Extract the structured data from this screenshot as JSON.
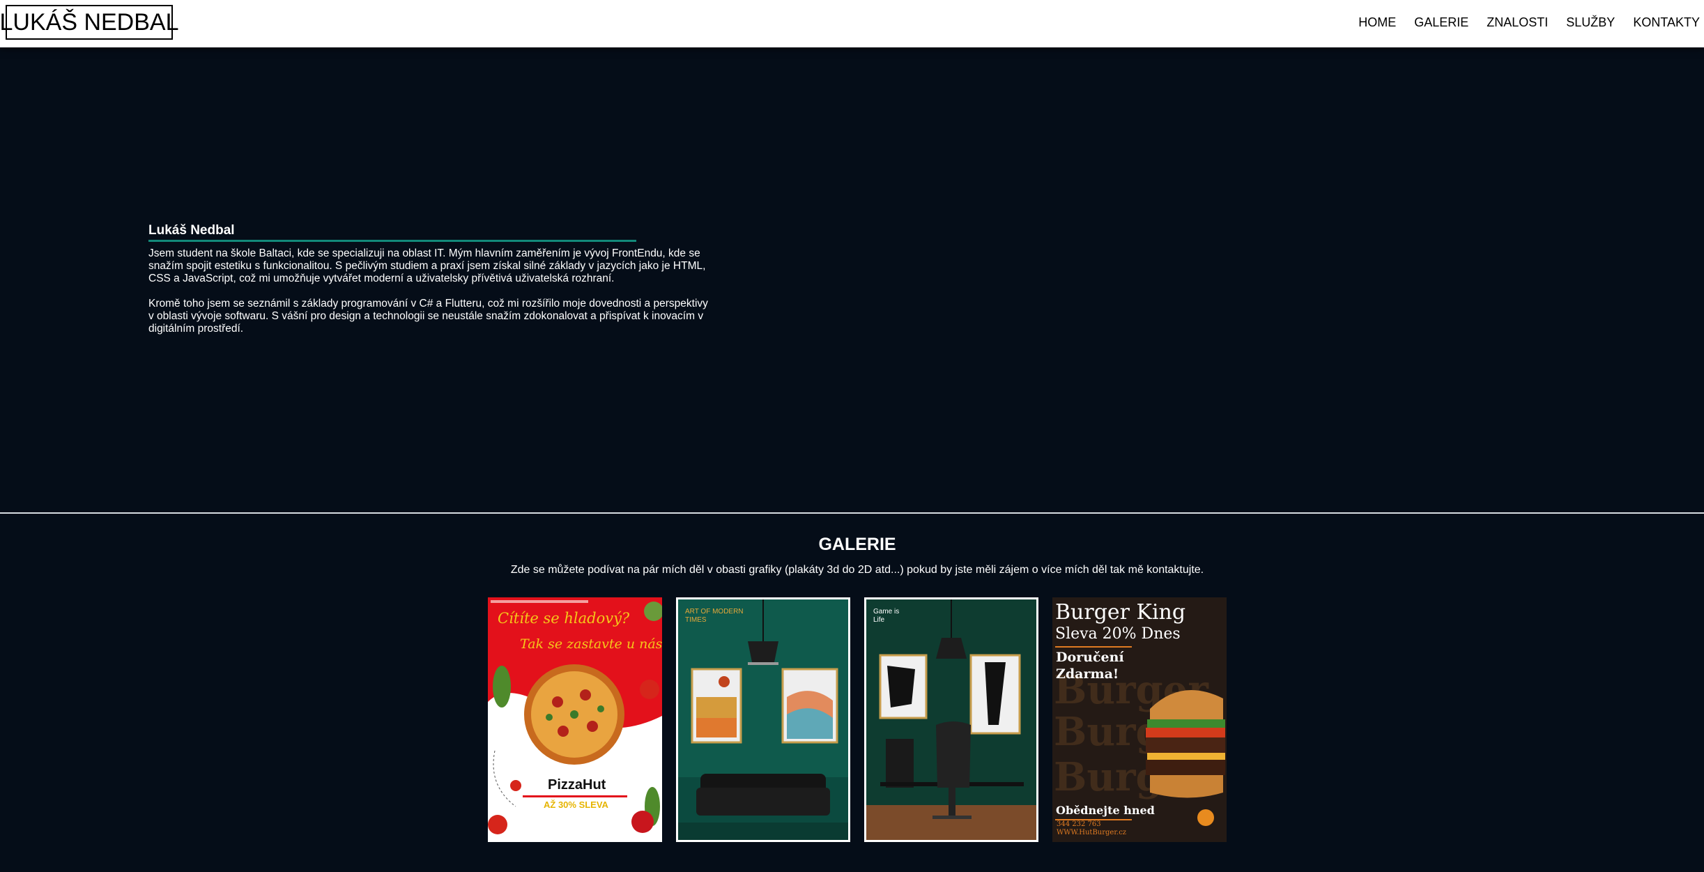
{
  "header": {
    "logo": "LUKÁŠ NEDBAL",
    "nav": [
      "HOME",
      "GALERIE",
      "ZNALOSTI",
      "SLUŽBY",
      "KONTAKTY"
    ]
  },
  "about": {
    "name": "Lukáš Nedbal",
    "paragraph1": "Jsem student na škole Baltaci, kde se specializuji na oblast IT. Mým hlavním zaměřením je vývoj FrontEndu, kde se snažím spojit estetiku s funkcionalitou. S pečlivým studiem a praxí jsem získal silné základy v jazycích jako je HTML, CSS a JavaScript, což mi umožňuje vytvářet moderní a uživatelsky přívětivá uživatelská rozhraní.",
    "paragraph2": "Kromě toho jsem se seznámil s základy programování v C# a Flutteru, což mi rozšířilo moje dovednosti a perspektivy v oblasti vývoje softwaru. S vášní pro design a technologii se neustále snažím zdokonalovat a přispívat k inovacím v digitálním prostředí."
  },
  "gallery": {
    "title": "GALERIE",
    "description": "Zde se můžete podívat na pár mích děl v obasti grafiky (plakáty 3d do 2D atd...) pokud by jste měli zájem o více mích děl tak mě kontaktujte.",
    "posters": {
      "pizza": {
        "line1": "Cítíte se hladový?",
        "line2": "Tak se zastavte u nás",
        "brand": "PizzaHut",
        "offer": "AŽ 30% SLEVA"
      },
      "room1": {
        "caption": "ART OF MODERN TIMES"
      },
      "room2": {
        "caption": "Game is Life"
      },
      "burger": {
        "brand": "Burger King",
        "offer": "Sleva 20% Dnes",
        "delivery": "Doručení Zdarma!",
        "cta": "Obědnejte hned",
        "phone": "344 232 763",
        "web": "WWW.HutBurger.cz",
        "bg_word": "Burger"
      }
    }
  },
  "colors": {
    "background": "#050d18",
    "accent_line": "#12897a",
    "header_bg": "#ffffff"
  }
}
